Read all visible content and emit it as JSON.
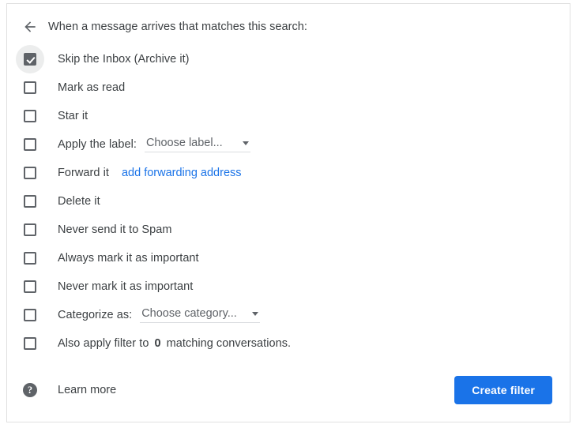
{
  "header": {
    "back_icon": "arrow-left-icon",
    "title": "When a message arrives that matches this search:"
  },
  "actions": [
    {
      "id": "skip-inbox",
      "label": "Skip the Inbox (Archive it)",
      "checked": true
    },
    {
      "id": "mark-as-read",
      "label": "Mark as read",
      "checked": false
    },
    {
      "id": "star-it",
      "label": "Star it",
      "checked": false
    },
    {
      "id": "apply-label",
      "label": "Apply the label:",
      "checked": false
    },
    {
      "id": "forward-it",
      "label": "Forward it",
      "checked": false
    },
    {
      "id": "delete-it",
      "label": "Delete it",
      "checked": false
    },
    {
      "id": "never-send-spam",
      "label": "Never send it to Spam",
      "checked": false
    },
    {
      "id": "always-important",
      "label": "Always mark it as important",
      "checked": false
    },
    {
      "id": "never-important",
      "label": "Never mark it as important",
      "checked": false
    },
    {
      "id": "categorize-as",
      "label": "Categorize as:",
      "checked": false
    },
    {
      "id": "also-apply-filter",
      "label_before": "Also apply filter to",
      "match_count": "0",
      "label_after": "matching conversations.",
      "checked": false
    }
  ],
  "label_select": {
    "value": "Choose label...",
    "caret_icon": "chevron-down-icon"
  },
  "category_select": {
    "value": "Choose category...",
    "caret_icon": "chevron-down-icon"
  },
  "forward_link": {
    "text": "add forwarding address"
  },
  "footer": {
    "help_icon": "help-circle-icon",
    "help_glyph": "?",
    "learn_more": "Learn more",
    "create_button": "Create filter"
  },
  "colors": {
    "accent_blue": "#1a73e8",
    "text_primary": "#3c4043",
    "text_secondary": "#5f6368",
    "border": "#e0e0e0",
    "ripple": "#eceded"
  }
}
